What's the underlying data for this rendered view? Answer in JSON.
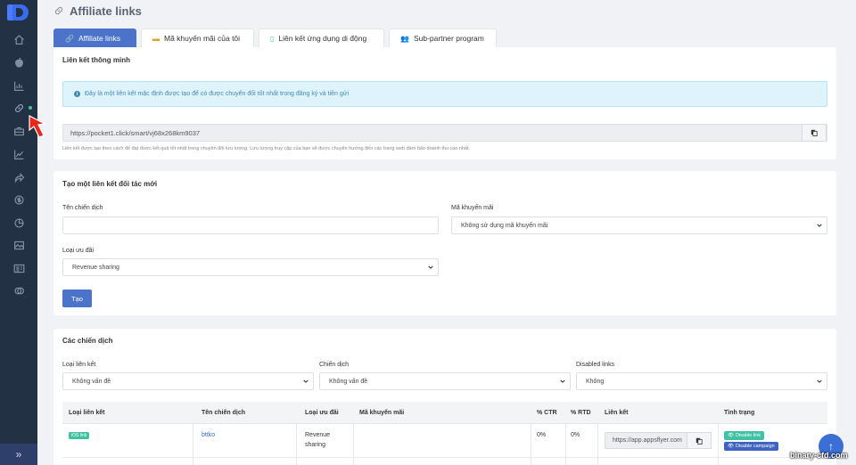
{
  "header": {
    "title": "Affiliate links"
  },
  "tabs": [
    {
      "label": "Affiliate links"
    },
    {
      "label": "Mã khuyến mãi của tôi"
    },
    {
      "label": "Liên kết ứng dụng di động"
    },
    {
      "label": "Sub-partner program"
    }
  ],
  "smart_link": {
    "title": "Liên kết thông minh",
    "alert": "Đây là một liên kết mặc định được tạo để có được chuyển đổi tốt nhất trong đăng ký và tiền gửi",
    "url": "https://pocket1.click/smart/vj68x268km9037",
    "hint": "Liên kết được tạo theo cách để đạt được kết quả tốt nhất trong chuyển đổi lưu lượng. Lưu lượng truy cập của bạn sẽ được chuyển hướng đến các trang web đảm bảo doanh thu cao nhất."
  },
  "create_form": {
    "title": "Tạo một liên kết đối tác mới",
    "campaign_label": "Tên chiến dịch",
    "campaign_value": "",
    "promo_label": "Mã khuyến mãi",
    "promo_value": "Không sử dụng mã khuyến mãi",
    "offer_label": "Loại ưu đãi",
    "offer_value": "Revenue sharing",
    "submit_label": "Tạo"
  },
  "campaigns": {
    "title": "Các chiến dịch",
    "filters": [
      {
        "label": "Loại liên kết",
        "value": "Không vấn đề"
      },
      {
        "label": "Chiến dịch",
        "value": "Không vấn đề"
      },
      {
        "label": "Disabled links",
        "value": "Không"
      }
    ],
    "columns": [
      "Loại liên kết",
      "Tên chiến dịch",
      "Loại ưu đãi",
      "Mã khuyến mãi",
      "% CTR",
      "% RTD",
      "Liên kết",
      "Tình trạng"
    ],
    "rows": [
      {
        "link_type": "iOS link",
        "campaign": "bttko",
        "offer_line1": "Revenue",
        "offer_line2": "sharing",
        "promo": "",
        "ctr": "0%",
        "rtd": "0%",
        "link": "https://app.appsflyer.com",
        "status_1": "Disable link",
        "status_2": "Disable campaign"
      }
    ]
  },
  "watermark": "binary-cfd.com",
  "icons": [
    "home-icon",
    "apple-icon",
    "bar-chart-icon",
    "link-icon",
    "briefcase-icon",
    "trend-icon",
    "share-icon",
    "coin-icon",
    "pie-chart-icon",
    "image-icon",
    "id-card-icon",
    "gift-icon"
  ],
  "colors": {
    "primary": "#4b73c9",
    "sidebar": "#233144",
    "badge": "#3fc2a3",
    "disable_campaign": "#3f64c0"
  }
}
